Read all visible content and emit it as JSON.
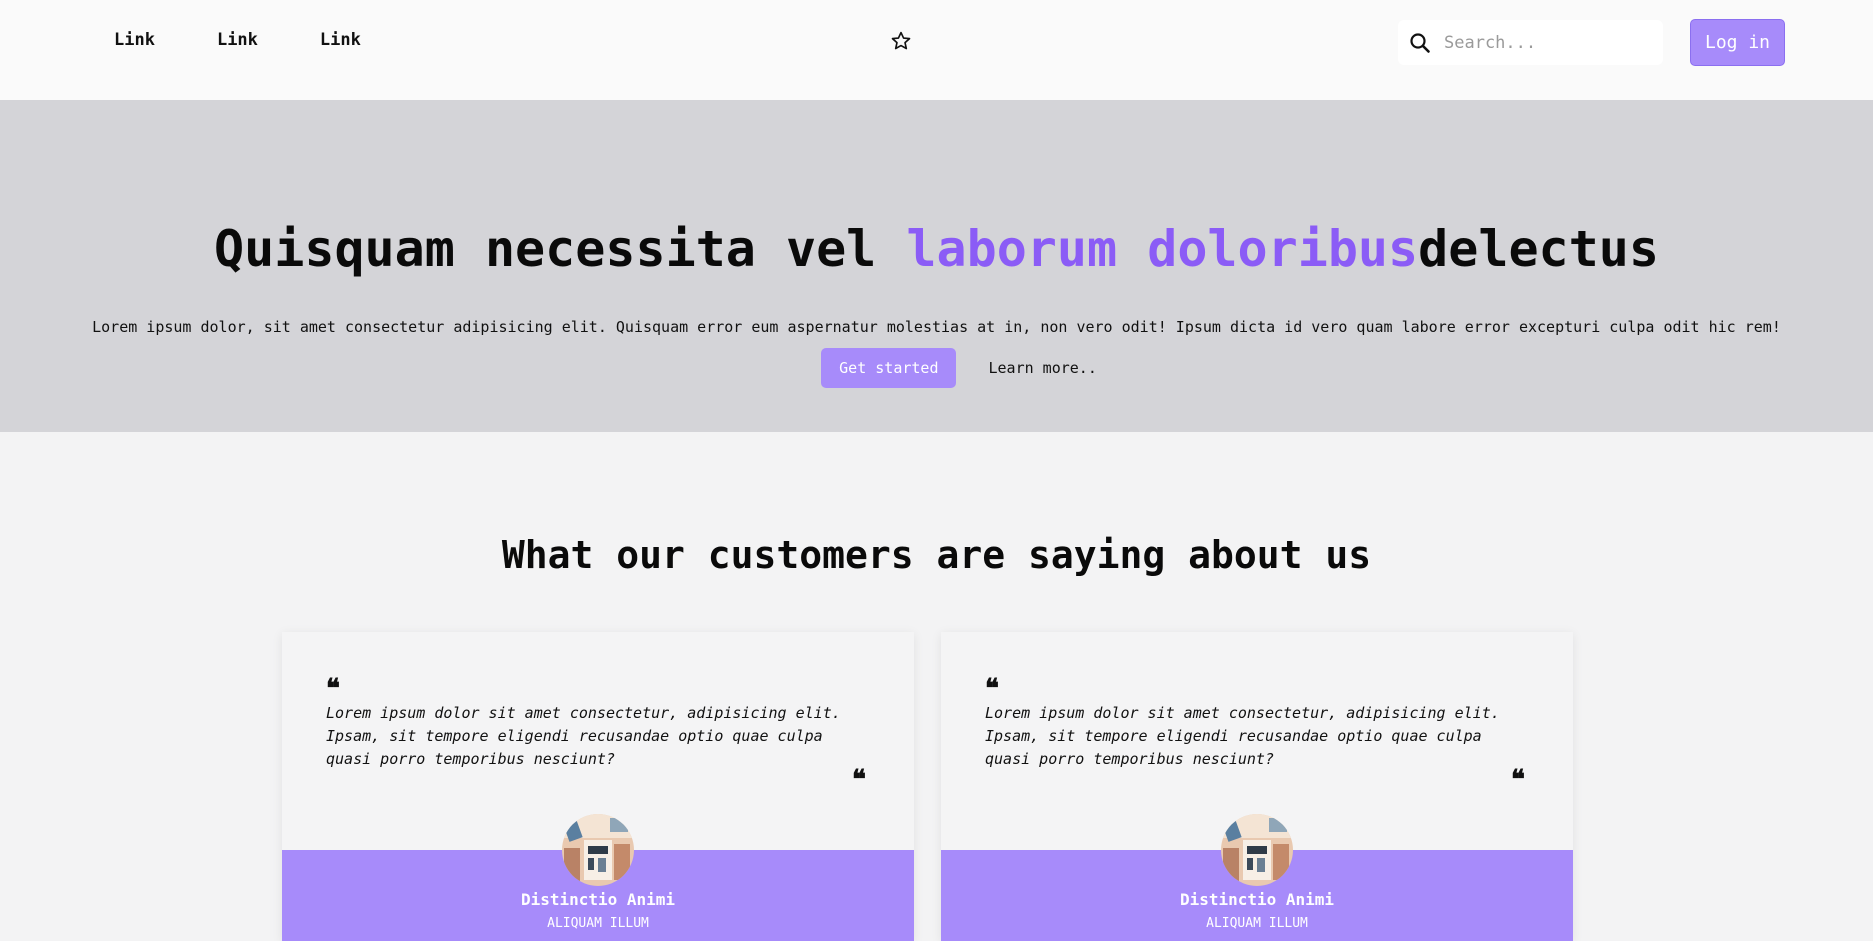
{
  "nav": {
    "links": [
      "Link",
      "Link",
      "Link"
    ],
    "search_placeholder": "Search...",
    "login_label": "Log in"
  },
  "hero": {
    "title_part1": "Quisquam necessita vel ",
    "title_accent": "laborum doloribus",
    "title_part2": "delectus",
    "subtitle": "Lorem ipsum dolor, sit amet consectetur adipisicing elit. Quisquam error eum aspernatur molestias at in, non vero odit! Ipsum dicta id vero quam labore error excepturi culpa odit hic rem!",
    "cta_primary": "Get started",
    "cta_secondary": "Learn more.."
  },
  "testimonials": {
    "heading": "What our customers are saying about us",
    "items": [
      {
        "quote": "Lorem ipsum dolor sit amet consectetur, adipisicing elit. Ipsam, sit tempore eligendi recusandae optio quae culpa quasi porro temporibus nesciunt?",
        "name": "Distinctio Animi",
        "role": "ALIQUAM ILLUM"
      },
      {
        "quote": "Lorem ipsum dolor sit amet consectetur, adipisicing elit. Ipsam, sit tempore eligendi recusandae optio quae culpa quasi porro temporibus nesciunt?",
        "name": "Distinctio Animi",
        "role": "ALIQUAM ILLUM"
      }
    ]
  },
  "icons": {
    "star": "star-icon",
    "search": "search-icon",
    "quote": "quote-icon"
  },
  "colors": {
    "accent": "#8b5cf6",
    "accent_light": "#a78bfa",
    "hero_bg": "#d4d4d8",
    "page_bg": "#f3f3f4"
  }
}
